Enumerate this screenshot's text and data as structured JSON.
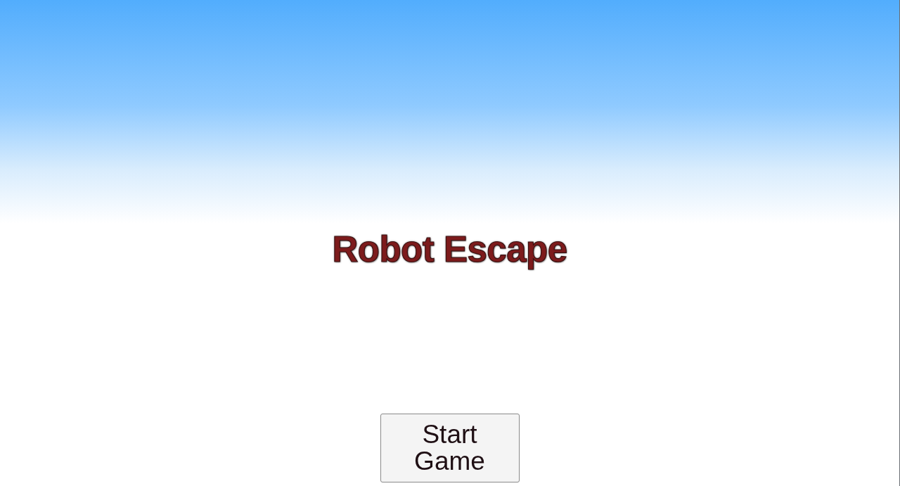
{
  "title": "Robot Escape",
  "buttons": [
    {
      "label": "Start Game"
    }
  ]
}
